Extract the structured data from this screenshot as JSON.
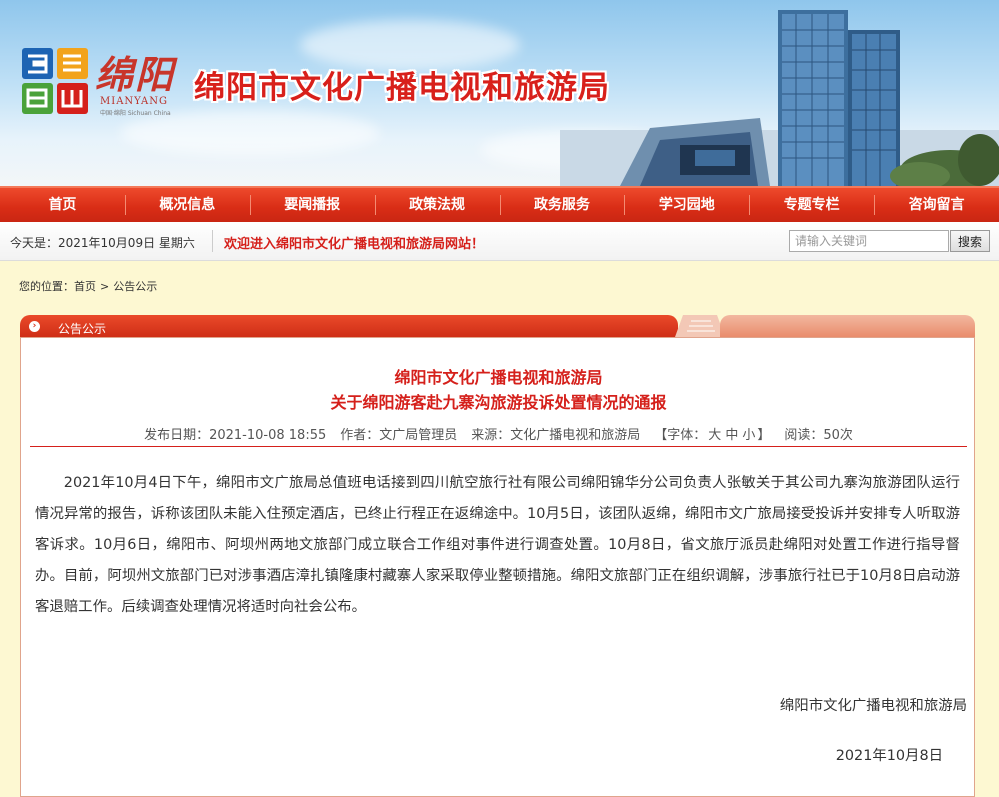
{
  "header": {
    "logo_text": "绵阳",
    "logo_subtitle": "MIANYANG",
    "logo_subtitle_small": "中国·绵阳 Sichuan China",
    "site_title": "绵阳市文化广播电视和旅游局"
  },
  "nav": {
    "items": [
      "首页",
      "概况信息",
      "要闻播报",
      "政策法规",
      "政务服务",
      "学习园地",
      "专题专栏",
      "咨询留言"
    ]
  },
  "strip": {
    "date_label": "今天是：2021年10月09日 星期六",
    "welcome": "欢迎进入绵阳市文化广播电视和旅游局网站！",
    "search_placeholder": "请输入关键词",
    "search_button": "搜索"
  },
  "breadcrumb": {
    "prefix": "您的位置：",
    "home": "首页",
    "separator": ">",
    "current": "公告公示"
  },
  "panel": {
    "tab_label": "公告公示"
  },
  "article": {
    "title_line1": "绵阳市文化广播电视和旅游局",
    "title_line2": "关于绵阳游客赴九寨沟旅游投诉处置情况的通报",
    "publish_label": "发布日期：2021-10-08 18:55",
    "author_label": "作者：文广局管理员",
    "source_label": "来源：文化广播电视和旅游局",
    "font_label": "【字体：",
    "font_large": "大",
    "font_medium": "中",
    "font_small": "小",
    "font_close": "】",
    "reads_label": "阅读：50次",
    "body": "2021年10月4日下午，绵阳市文广旅局总值班电话接到四川航空旅行社有限公司绵阳锦华分公司负责人张敏关于其公司九寨沟旅游团队运行情况异常的报告，诉称该团队未能入住预定酒店，已终止行程正在返绵途中。10月5日，该团队返绵，绵阳市文广旅局接受投诉并安排专人听取游客诉求。10月6日，绵阳市、阿坝州两地文旅部门成立联合工作组对事件进行调查处置。10月8日，省文旅厅派员赴绵阳对处置工作进行指导督办。目前，阿坝州文旅部门已对涉事酒店漳扎镇隆康村藏寨人家采取停业整顿措施。绵阳文旅部门正在组织调解，涉事旅行社已于10月8日启动游客退赔工作。后续调查处理情况将适时向社会公布。",
    "signature": "绵阳市文化广播电视和旅游局",
    "sign_date": "2021年10月8日"
  },
  "colors": {
    "brand_red": "#d5201b",
    "nav_red": "#d92d16",
    "page_bg": "#fdf8d2"
  }
}
